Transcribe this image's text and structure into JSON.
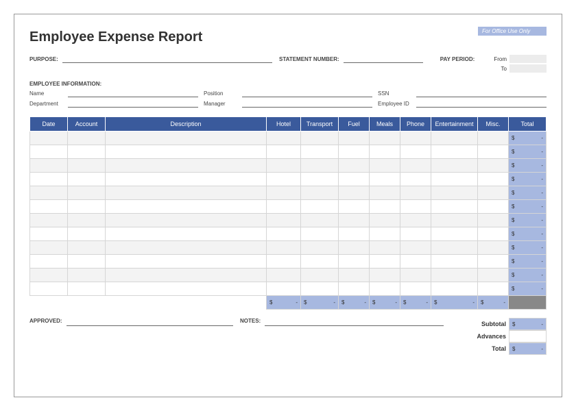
{
  "officeTag": "For Office Use Only",
  "title": "Employee Expense Report",
  "labels": {
    "purpose": "PURPOSE:",
    "statementNumber": "STATEMENT NUMBER:",
    "payPeriod": "PAY PERIOD:",
    "from": "From",
    "to": "To",
    "employeeInfo": "EMPLOYEE INFORMATION:",
    "name": "Name",
    "department": "Department",
    "position": "Position",
    "manager": "Manager",
    "ssn": "SSN",
    "employeeId": "Employee ID",
    "approved": "APPROVED:",
    "notes": "NOTES:",
    "subtotal": "Subtotal",
    "advances": "Advances",
    "total": "Total"
  },
  "fields": {
    "purpose": "",
    "statementNumber": "",
    "payFrom": "",
    "payTo": "",
    "name": "",
    "department": "",
    "position": "",
    "manager": "",
    "ssn": "",
    "employeeId": "",
    "approved": "",
    "notes": ""
  },
  "columns": [
    "Date",
    "Account",
    "Description",
    "Hotel",
    "Transport",
    "Fuel",
    "Meals",
    "Phone",
    "Entertainment",
    "Misc.",
    "Total"
  ],
  "currencySymbol": "$",
  "dashValue": "-",
  "rowCount": 12,
  "summary": {
    "subtotal": "-",
    "advances": "",
    "total": "-"
  }
}
